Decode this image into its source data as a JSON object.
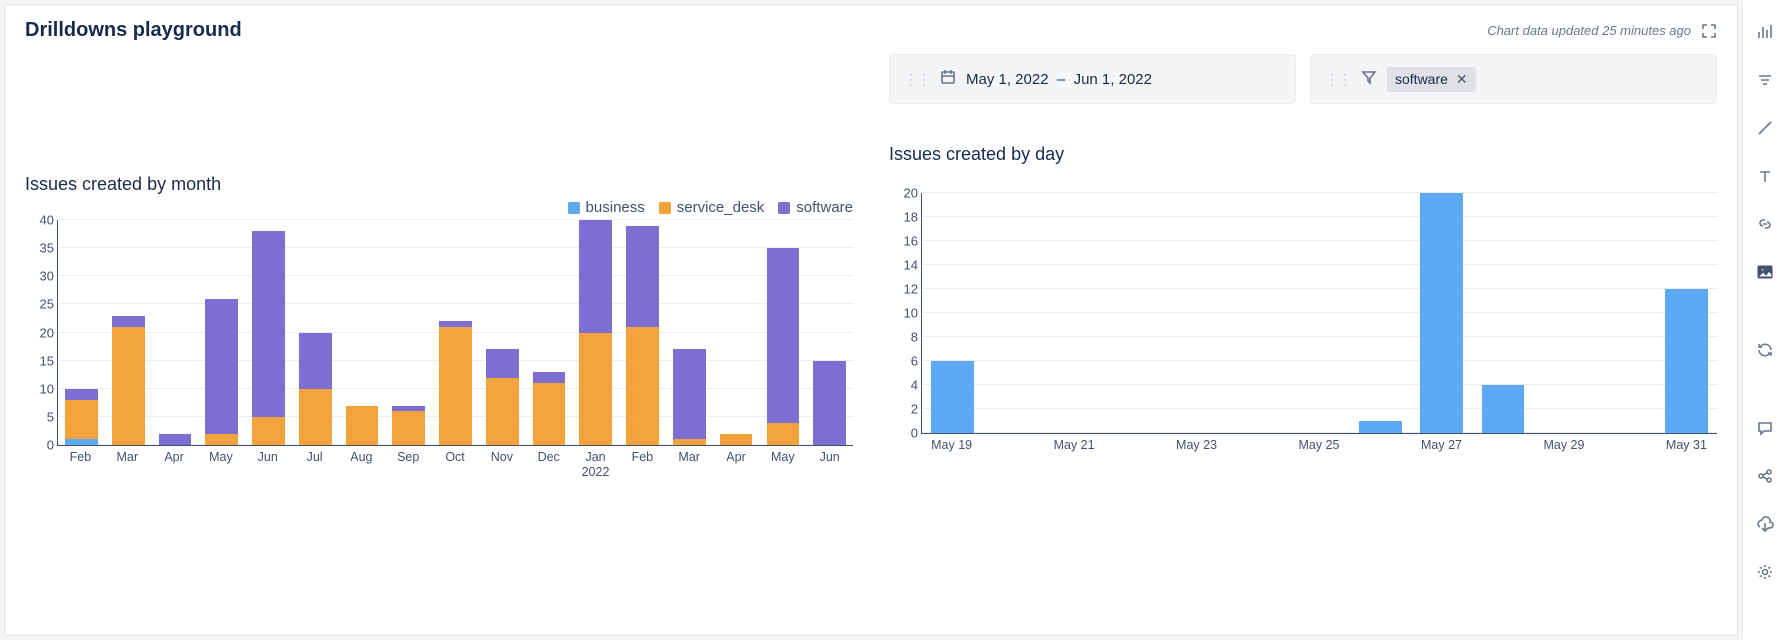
{
  "header": {
    "title": "Drilldowns playground",
    "status": "Chart data updated 25 minutes ago"
  },
  "left": {
    "title": "Issues created by month",
    "legend": [
      "business",
      "service_desk",
      "software"
    ]
  },
  "right": {
    "title": "Issues created by day",
    "date_filter": {
      "start": "May 1, 2022",
      "end": "Jun 1, 2022"
    },
    "tag_filter": {
      "label": "software"
    }
  },
  "colors": {
    "business": "#5ea9f3",
    "service_desk": "#f2a33c",
    "software": "#7c6fd1"
  },
  "chart_data": [
    {
      "type": "bar",
      "stacked": true,
      "title": "Issues created by month",
      "ylabel": "",
      "ylim": [
        0,
        40
      ],
      "yticks": [
        0,
        5,
        10,
        15,
        20,
        25,
        30,
        35,
        40
      ],
      "categories": [
        "Feb",
        "Mar",
        "Apr",
        "May",
        "Jun",
        "Jul",
        "Aug",
        "Sep",
        "Oct",
        "Nov",
        "Dec",
        "Jan\n2022",
        "Feb",
        "Mar",
        "Apr",
        "May",
        "Jun"
      ],
      "series": [
        {
          "name": "business",
          "values": [
            1,
            0,
            0,
            0,
            0,
            0,
            0,
            0,
            0,
            0,
            0,
            0,
            0,
            0,
            0,
            0,
            0
          ]
        },
        {
          "name": "service_desk",
          "values": [
            7,
            21,
            0,
            2,
            5,
            10,
            7,
            6,
            21,
            12,
            11,
            20,
            21,
            1,
            2,
            4,
            0
          ]
        },
        {
          "name": "software",
          "values": [
            2,
            2,
            2,
            24,
            33,
            10,
            0,
            1,
            1,
            5,
            2,
            20,
            18,
            16,
            0,
            31,
            15
          ]
        }
      ]
    },
    {
      "type": "bar",
      "stacked": false,
      "title": "Issues created by day",
      "ylabel": "",
      "ylim": [
        0,
        20
      ],
      "yticks": [
        0,
        2,
        4,
        6,
        8,
        10,
        12,
        14,
        16,
        18,
        20
      ],
      "categories": [
        "May 19",
        "May 20",
        "May 21",
        "May 22",
        "May 23",
        "May 24",
        "May 25",
        "May 26",
        "May 27",
        "May 28",
        "May 29",
        "May 30",
        "May 31"
      ],
      "xlabel_mod": 2,
      "series": [
        {
          "name": "software",
          "values": [
            6,
            0,
            0,
            0,
            0,
            0,
            0,
            1,
            20,
            4,
            0,
            0,
            12
          ]
        }
      ],
      "single_color": "#5ea9f3"
    }
  ]
}
